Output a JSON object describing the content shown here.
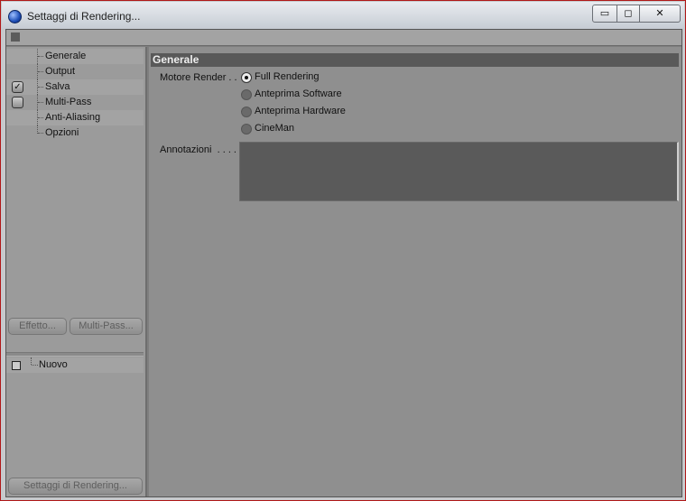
{
  "window": {
    "title": "Settaggi di Rendering...",
    "minimize_glyph": "▭",
    "maximize_glyph": "◻",
    "close_glyph": "✕"
  },
  "sidebar": {
    "items": [
      {
        "label": "Generale",
        "checkbox": null
      },
      {
        "label": "Output",
        "checkbox": null
      },
      {
        "label": "Salva",
        "checkbox": "checked"
      },
      {
        "label": "Multi-Pass",
        "checkbox": "unchecked"
      },
      {
        "label": "Anti-Aliasing",
        "checkbox": null
      },
      {
        "label": "Opzioni",
        "checkbox": null
      }
    ],
    "check_glyph": "✓",
    "effect_button": "Effetto...",
    "multipass_button": "Multi-Pass...",
    "new_item": "Nuovo",
    "render_settings_button": "Settaggi di Rendering..."
  },
  "main": {
    "section_title": "Generale",
    "render_engine_label": "Motore Render . .",
    "render_options": [
      {
        "label": "Full Rendering",
        "selected": true
      },
      {
        "label": "Anteprima Software",
        "selected": false
      },
      {
        "label": "Anteprima Hardware",
        "selected": false
      },
      {
        "label": "CineMan",
        "selected": false
      }
    ],
    "notes_label": "Annotazioni  . . . .",
    "notes_value": ""
  }
}
